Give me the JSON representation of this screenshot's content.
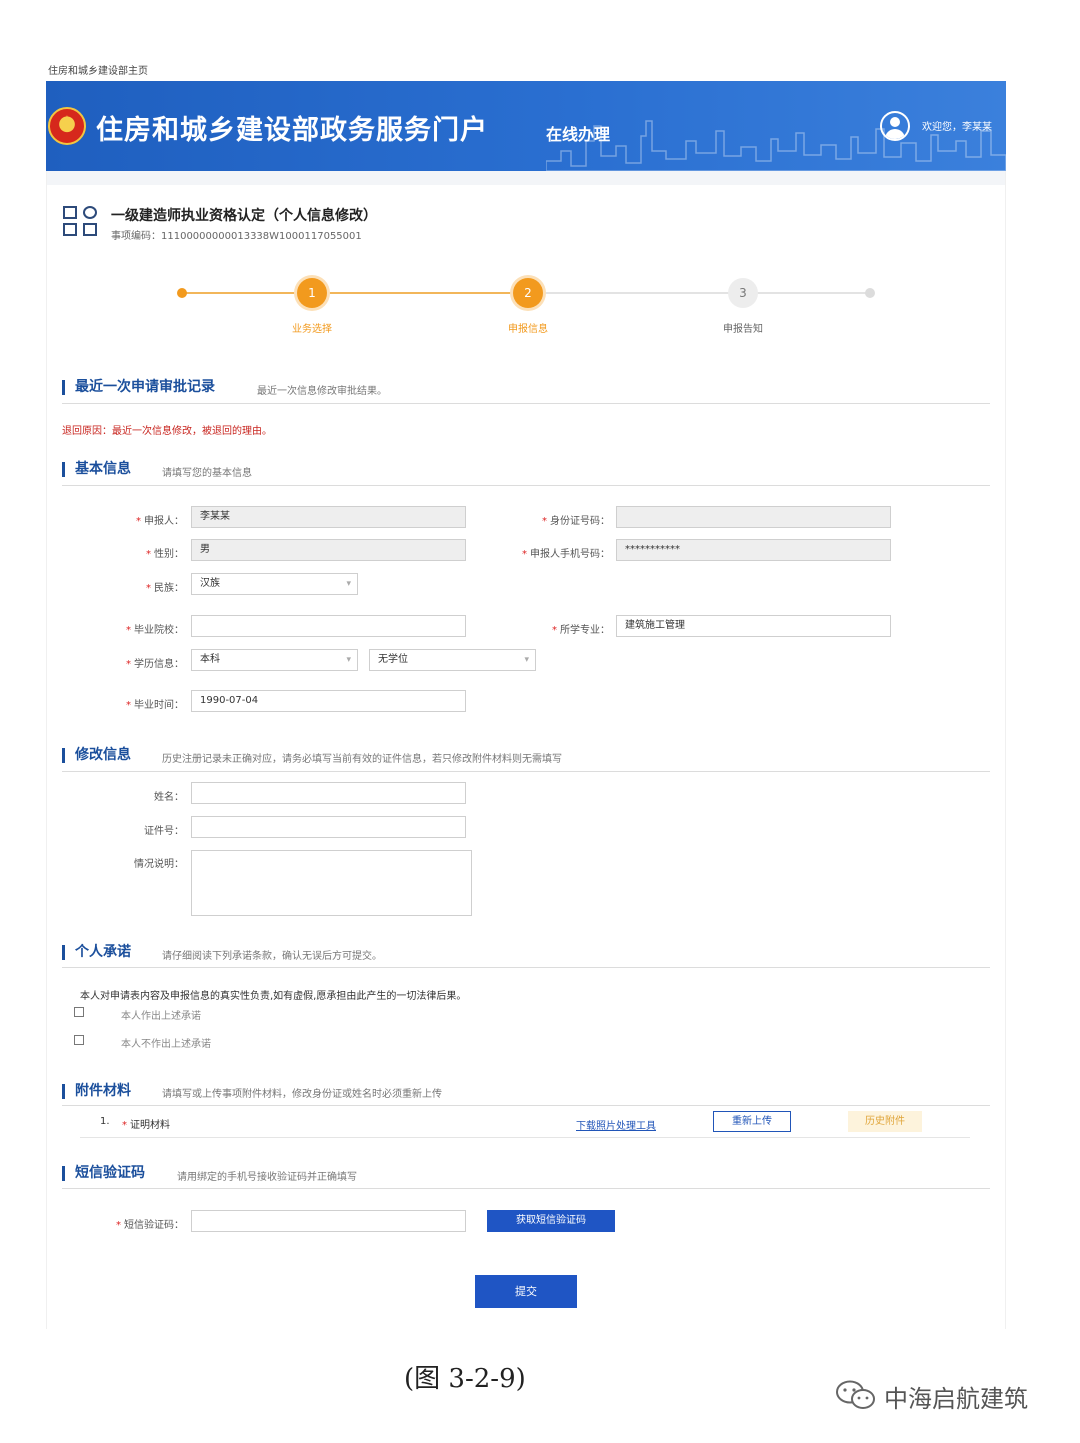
{
  "breadcrumb": "住房和城乡建设部主页",
  "header": {
    "title": "住房和城乡建设部政务服务门户",
    "subtitle": "在线办理",
    "welcome": "欢迎您，李某某"
  },
  "form": {
    "title": "一级建造师执业资格认定（个人信息修改）",
    "code_label": "事项编码：",
    "code_value": "11100000000013338W1000117055001"
  },
  "steps": [
    {
      "num": "1",
      "label": "业务选择",
      "status": "done"
    },
    {
      "num": "2",
      "label": "申报信息",
      "status": "active"
    },
    {
      "num": "3",
      "label": "申报告知",
      "status": "pending"
    }
  ],
  "sections": {
    "recent": {
      "title": "最近一次申请审批记录",
      "desc": "最近一次信息修改审批结果。",
      "reject_text": "退回原因：最近一次信息修改，被退回的理由。"
    },
    "basic": {
      "title": "基本信息",
      "desc": "请填写您的基本信息"
    },
    "modify": {
      "title": "修改信息",
      "desc": "历史注册记录未正确对应，请务必填写当前有效的证件信息，若只修改附件材料则无需填写"
    },
    "commit": {
      "title": "个人承诺",
      "desc": "请仔细阅读下列承诺条款，确认无误后方可提交。"
    },
    "attach": {
      "title": "附件材料",
      "desc": "请填写或上传事项附件材料，修改身份证或姓名时必须重新上传"
    },
    "sms": {
      "title": "短信验证码",
      "desc": "请用绑定的手机号接收验证码并正确填写"
    }
  },
  "basic_fields": {
    "applicant": {
      "label": "申报人：",
      "value": "李某某"
    },
    "id_number": {
      "label": "身份证号码：",
      "value": ""
    },
    "gender": {
      "label": "性别：",
      "value": "男"
    },
    "phone": {
      "label": "申报人手机号码：",
      "value": "***********"
    },
    "ethnicity": {
      "label": "民族：",
      "value": "汉族"
    },
    "school": {
      "label": "毕业院校：",
      "value": ""
    },
    "major": {
      "label": "所学专业：",
      "value": "建筑施工管理"
    },
    "education": {
      "label": "学历信息：",
      "value": "本科",
      "degree": "无学位"
    },
    "grad_date": {
      "label": "毕业时间：",
      "value": "1990-07-04"
    }
  },
  "modify_fields": {
    "name": {
      "label": "姓名：",
      "value": ""
    },
    "cert_no": {
      "label": "证件号：",
      "value": ""
    },
    "note": {
      "label": "情况说明：",
      "value": ""
    }
  },
  "commitment": {
    "statement": "本人对申请表内容及申报信息的真实性负责,如有虚假,愿承担由此产生的一切法律后果。",
    "option_agree": "本人作出上述承诺",
    "option_disagree": "本人不作出上述承诺"
  },
  "attachment": {
    "num": "1.",
    "name": "证明材料",
    "download_link": "下载照片处理工具",
    "reupload": "重新上传",
    "history": "历史附件"
  },
  "sms": {
    "label": "短信验证码：",
    "value": "",
    "get_code": "获取短信验证码"
  },
  "submit": "提交",
  "caption": "(图 3-2-9)",
  "watermark": "中海启航建筑",
  "colors": {
    "header_blue": "#2a6fd1",
    "section_blue": "#1b4f9c",
    "step_orange": "#f29a1e",
    "reject_red": "#c8251f",
    "button_blue": "#1f55c4"
  }
}
